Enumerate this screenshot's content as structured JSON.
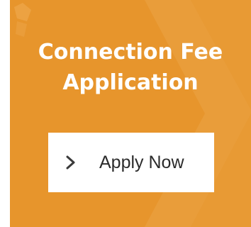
{
  "card": {
    "title_line1": "Connection Fee",
    "title_line2": "Application",
    "background_color": "#e7952c"
  },
  "button": {
    "label": "Apply Now",
    "icon": "chevron-right-icon"
  }
}
